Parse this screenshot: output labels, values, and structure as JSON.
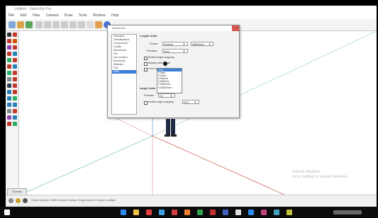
{
  "window": {
    "title": "Untitled - SketchUp Pro"
  },
  "menu": [
    "File",
    "Edit",
    "View",
    "Camera",
    "Draw",
    "Tools",
    "Window",
    "Help"
  ],
  "dialog": {
    "title": "Model Info",
    "categories": [
      "Animation",
      "Classifications",
      "Components",
      "Credits",
      "Dimensions",
      "File",
      "Geo-location",
      "Rendering",
      "Statistics",
      "Text",
      "Units"
    ],
    "selected_category": "Units",
    "length_section": "Length Units",
    "format_label": "Format",
    "format_value": "Decimal",
    "format_unit": "Millimeters",
    "precision_label": "Precision",
    "precision_value": "0mm",
    "enable_snapping_label": "Enable length snapping",
    "snapping_value": "1mm",
    "display_units_label": "Display units format",
    "force_label": "Force display of 0\"",
    "dropdown_options": [
      "0mm",
      "0.0mm",
      "0.00mm",
      "0.000mm",
      "0.0000mm",
      "0.00000mm",
      "0.000000mm"
    ],
    "angle_section": "Angle Units",
    "angle_precision_label": "Precision",
    "angle_precision_value": "0.0",
    "angle_snapping_label": "Enable angle snapping",
    "angle_snapping_value": "15.0"
  },
  "scenes_tab": "Scenes",
  "status_text": "Select objects. Shift to extend select. Drag mouse to select multiple.",
  "watermark": [
    "Activate Windows",
    "Go to Settings to activate Windows."
  ],
  "colors": {
    "accent": "#3c7fd8",
    "axis_red": "#c0392b",
    "axis_green": "#27ae60",
    "axis_blue": "#2e6bd8"
  }
}
